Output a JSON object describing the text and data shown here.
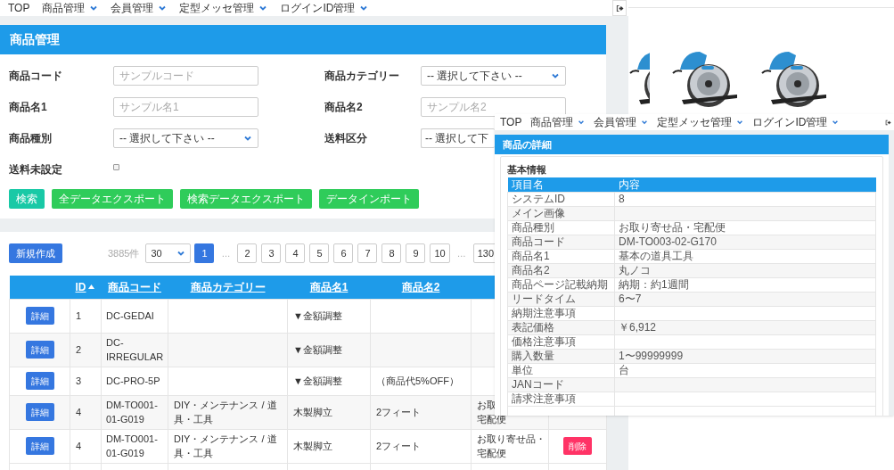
{
  "main_window": {
    "nav": [
      "TOP",
      "商品管理",
      "会員管理",
      "定型メッセ管理",
      "ログインID管理"
    ],
    "title": "商品管理",
    "form": [
      [
        {
          "label": "商品コード",
          "kind": "input",
          "placeholder": "サンプルコード"
        },
        {
          "label": "商品カテゴリー",
          "kind": "select",
          "value": "-- 選択して下さい --"
        }
      ],
      [
        {
          "label": "商品名1",
          "kind": "input",
          "placeholder": "サンプル名1"
        },
        {
          "label": "商品名2",
          "kind": "input",
          "placeholder": "サンプル名2"
        }
      ],
      [
        {
          "label": "商品種別",
          "kind": "select",
          "value": "-- 選択して下さい --"
        },
        {
          "label": "送料区分",
          "kind": "select",
          "value": "-- 選択して下"
        }
      ],
      [
        {
          "label": "送料未設定",
          "kind": "checkbox",
          "checked": false
        }
      ]
    ],
    "buttons": [
      {
        "label": "検索",
        "kind": "search"
      },
      {
        "label": "全データエクスポート",
        "kind": "export"
      },
      {
        "label": "検索データエクスポート",
        "kind": "export"
      },
      {
        "label": "データインポート",
        "kind": "export"
      }
    ],
    "new_button": "新規作成",
    "count": "3885件",
    "per_page": "30",
    "pages": [
      {
        "kind": "page",
        "label": "1",
        "selected": true
      },
      {
        "kind": "ellipsis",
        "label": "…"
      },
      {
        "kind": "page",
        "label": "2",
        "selected": false
      },
      {
        "kind": "page",
        "label": "3",
        "selected": false
      },
      {
        "kind": "page",
        "label": "4",
        "selected": false
      },
      {
        "kind": "page",
        "label": "5",
        "selected": false
      },
      {
        "kind": "page",
        "label": "6",
        "selected": false
      },
      {
        "kind": "page",
        "label": "7",
        "selected": false
      },
      {
        "kind": "page",
        "label": "8",
        "selected": false
      },
      {
        "kind": "page",
        "label": "9",
        "selected": false
      },
      {
        "kind": "page",
        "label": "10",
        "selected": false
      },
      {
        "kind": "ellipsis",
        "label": "…"
      },
      {
        "kind": "page",
        "label": "130",
        "selected": false
      }
    ],
    "table": {
      "columns": [
        "ID",
        "商品コード",
        "商品カテゴリー",
        "商品名1",
        "商品名2"
      ],
      "rows": [
        {
          "detail": "詳細",
          "id": "1",
          "code": "DC-GEDAI",
          "name1": "▼金額調整"
        },
        {
          "detail": "詳細",
          "id": "2",
          "code": "DC-IRREGULAR",
          "name1": "▼金額調整"
        },
        {
          "detail": "詳細",
          "id": "3",
          "code": "DC-PRO-5P",
          "name1": "▼金額調整",
          "name2": "（商品代5%OFF）"
        },
        {
          "detail": "詳細",
          "id": "4",
          "code": "DM-TO001-01-G019",
          "category": "DIY・メンテナンス / 道具・工具",
          "name1": "木製脚立",
          "name2": "2フィート",
          "column_7": [
            "お取",
            "宅配便"
          ]
        },
        {
          "detail": "詳細",
          "id": "4",
          "code": "DM-TO001-01-G019",
          "category": "DIY・メンテナンス / 道具・工具",
          "name1": "木製脚立",
          "name2": "2フィート",
          "column_7": [
            "お取り寄せ品・",
            "宅配便"
          ],
          "delete": "削除"
        }
      ]
    }
  },
  "detail_window": {
    "nav": [
      "TOP",
      "商品管理",
      "会員管理",
      "定型メッセ管理",
      "ログインID管理"
    ],
    "title": "商品の詳細",
    "section": "基本情報",
    "columns": [
      "項目名",
      "内容"
    ],
    "rows": [
      {
        "name": "システムID",
        "value": "8"
      },
      {
        "name": "メイン画像"
      },
      {
        "name": "商品種別",
        "value": "お取り寄せ品・宅配便"
      },
      {
        "name": "商品コード",
        "value": "DM-TO003-02-G170"
      },
      {
        "name": "商品名1",
        "value": "基本の道具工具"
      },
      {
        "name": "商品名2",
        "value": "丸ノコ"
      },
      {
        "name": "商品ページ記載納期",
        "value": "納期：約1週間"
      },
      {
        "name": "リードタイム",
        "value": "6〜7"
      },
      {
        "name": "納期注意事項"
      },
      {
        "name": "表記価格",
        "value": "￥6,912"
      },
      {
        "name": "価格注意事項"
      },
      {
        "name": "購入数量",
        "value": "1〜99999999"
      },
      {
        "name": "単位",
        "value": "台"
      },
      {
        "name": "JANコード"
      },
      {
        "name": "請求注意事項"
      }
    ]
  }
}
